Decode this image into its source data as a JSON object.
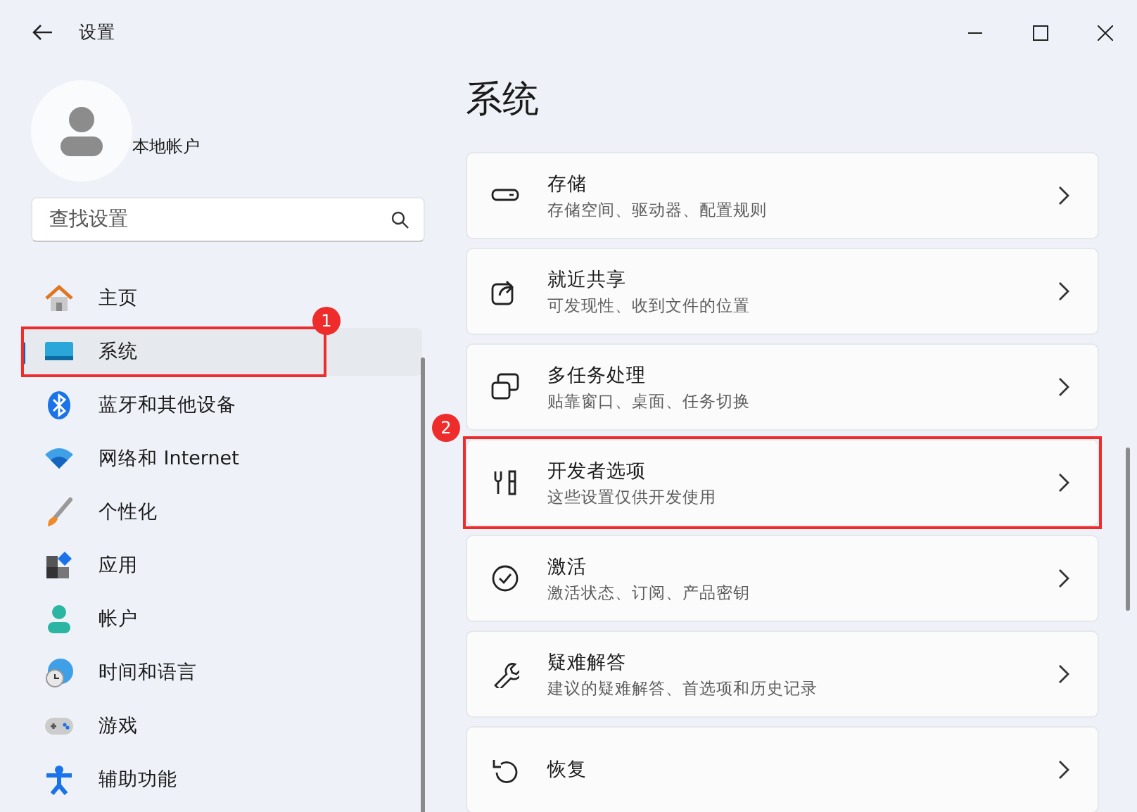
{
  "window": {
    "title": "设置"
  },
  "account": {
    "name": "本地帐户"
  },
  "search": {
    "placeholder": "查找设置"
  },
  "sidebar": {
    "items": [
      {
        "label": "主页",
        "selected": false,
        "marked": false
      },
      {
        "label": "系统",
        "selected": true,
        "marked": true,
        "marker": "1"
      },
      {
        "label": "蓝牙和其他设备",
        "selected": false,
        "marked": false
      },
      {
        "label": "网络和 Internet",
        "selected": false,
        "marked": false
      },
      {
        "label": "个性化",
        "selected": false,
        "marked": false
      },
      {
        "label": "应用",
        "selected": false,
        "marked": false
      },
      {
        "label": "帐户",
        "selected": false,
        "marked": false
      },
      {
        "label": "时间和语言",
        "selected": false,
        "marked": false
      },
      {
        "label": "游戏",
        "selected": false,
        "marked": false
      },
      {
        "label": "辅助功能",
        "selected": false,
        "marked": false
      }
    ]
  },
  "page": {
    "heading": "系统",
    "cards": [
      {
        "title": "存储",
        "subtitle": "存储空间、驱动器、配置规则",
        "marked": false
      },
      {
        "title": "就近共享",
        "subtitle": "可发现性、收到文件的位置",
        "marked": false
      },
      {
        "title": "多任务处理",
        "subtitle": "贴靠窗口、桌面、任务切换",
        "marked": false
      },
      {
        "title": "开发者选项",
        "subtitle": "这些设置仅供开发使用",
        "marked": true,
        "marker": "2"
      },
      {
        "title": "激活",
        "subtitle": "激活状态、订阅、产品密钥",
        "marked": false
      },
      {
        "title": "疑难解答",
        "subtitle": "建议的疑难解答、首选项和历史记录",
        "marked": false
      },
      {
        "title": "恢复",
        "marked": false
      }
    ]
  }
}
